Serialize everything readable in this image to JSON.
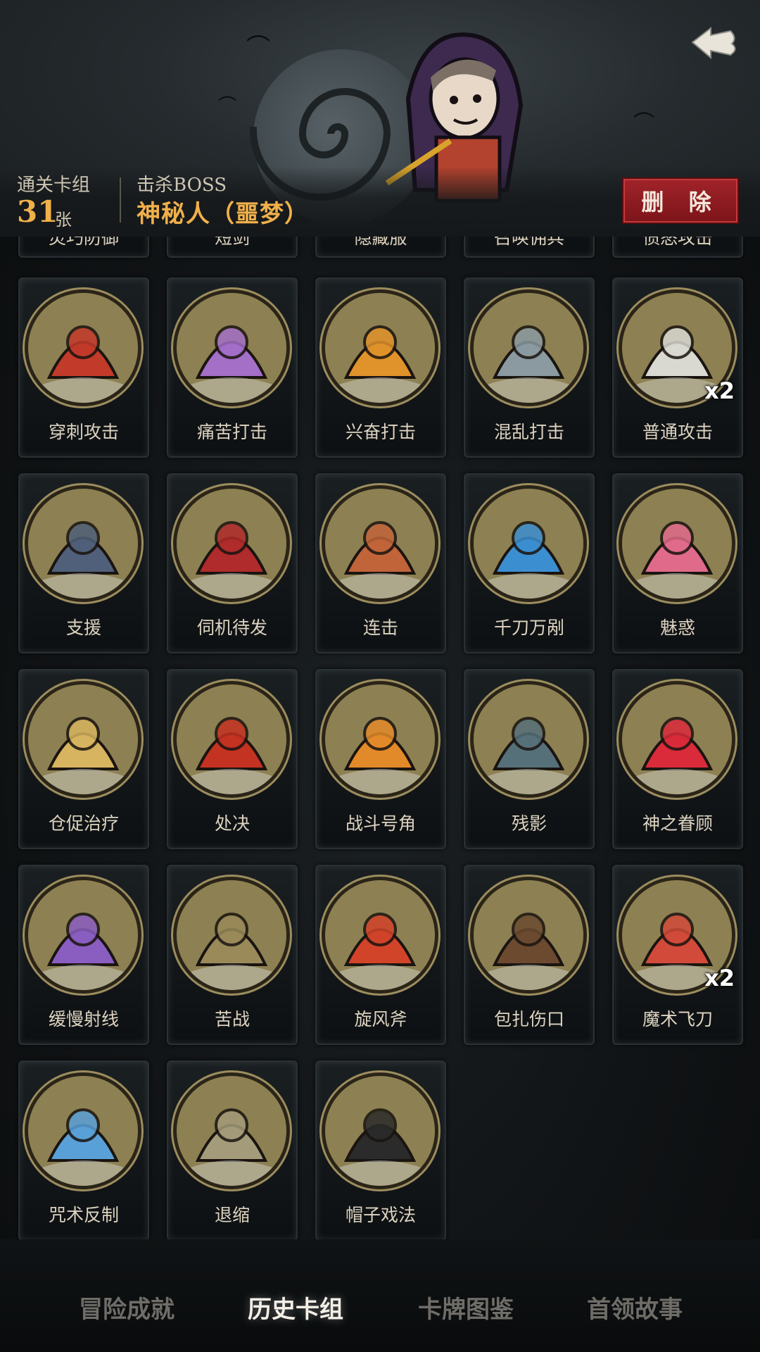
{
  "header": {
    "deck_label": "通关卡组",
    "deck_count": "31",
    "deck_unit": "张",
    "boss_label": "击杀BOSS",
    "boss_name": "神秘人（噩梦）",
    "delete_label": "删 除",
    "back_icon": "back-arrow-icon"
  },
  "partial_row": [
    "灵巧防御",
    "短剑",
    "隐藏服",
    "召唤佣兵",
    "愤怒攻击"
  ],
  "cards": [
    {
      "name": "穿刺攻击",
      "icon": "spikes-icon",
      "color": "#c23a2a",
      "mult": ""
    },
    {
      "name": "痛苦打击",
      "icon": "ghost-skull-icon",
      "color": "#a36fc7",
      "mult": ""
    },
    {
      "name": "兴奋打击",
      "icon": "hooded-warrior-icon",
      "color": "#e0922b",
      "mult": ""
    },
    {
      "name": "混乱打击",
      "icon": "hammer-icon",
      "color": "#8a9aa0",
      "mult": ""
    },
    {
      "name": "普通攻击",
      "icon": "sword-icon",
      "color": "#d9d9d2",
      "mult": "x2"
    },
    {
      "name": "支援",
      "icon": "assassin-icon",
      "color": "#50607a",
      "mult": ""
    },
    {
      "name": "伺机待发",
      "icon": "masked-rogue-icon",
      "color": "#b02b2b",
      "mult": ""
    },
    {
      "name": "连击",
      "icon": "archer-icon",
      "color": "#c1643a",
      "mult": ""
    },
    {
      "name": "千刀万剐",
      "icon": "blades-icon",
      "color": "#3b8fd1",
      "mult": ""
    },
    {
      "name": "魅惑",
      "icon": "charm-hearts-icon",
      "color": "#e06a8a",
      "mult": ""
    },
    {
      "name": "仓促治疗",
      "icon": "scroll-icon",
      "color": "#d6b460",
      "mult": ""
    },
    {
      "name": "处决",
      "icon": "execution-icon",
      "color": "#c43222",
      "mult": ""
    },
    {
      "name": "战斗号角",
      "icon": "horn-icon",
      "color": "#e28a2a",
      "mult": ""
    },
    {
      "name": "残影",
      "icon": "shadow-clones-icon",
      "color": "#56707a",
      "mult": ""
    },
    {
      "name": "神之眷顾",
      "icon": "angel-heart-icon",
      "color": "#d92b3a",
      "mult": ""
    },
    {
      "name": "缓慢射线",
      "icon": "wizard-icon",
      "color": "#8a5dc0",
      "mult": ""
    },
    {
      "name": "苦战",
      "icon": "shield-warrior-icon",
      "color": "#9a8a5a",
      "mult": ""
    },
    {
      "name": "旋风斧",
      "icon": "axe-icon",
      "color": "#d2442a",
      "mult": ""
    },
    {
      "name": "包扎伤口",
      "icon": "plague-doctor-icon",
      "color": "#6b4a30",
      "mult": ""
    },
    {
      "name": "魔术飞刀",
      "icon": "clown-icon",
      "color": "#d24a3a",
      "mult": "x2"
    },
    {
      "name": "咒术反制",
      "icon": "witch-icon",
      "color": "#5aa0d8",
      "mult": ""
    },
    {
      "name": "退缩",
      "icon": "retreat-icon",
      "color": "#a49b7a",
      "mult": ""
    },
    {
      "name": "帽子戏法",
      "icon": "rabbit-hat-icon",
      "color": "#2b2b2b",
      "mult": ""
    }
  ],
  "tabs": [
    {
      "label": "冒险成就",
      "active": false
    },
    {
      "label": "历史卡组",
      "active": true
    },
    {
      "label": "卡牌图鉴",
      "active": false
    },
    {
      "label": "首领故事",
      "active": false
    }
  ]
}
